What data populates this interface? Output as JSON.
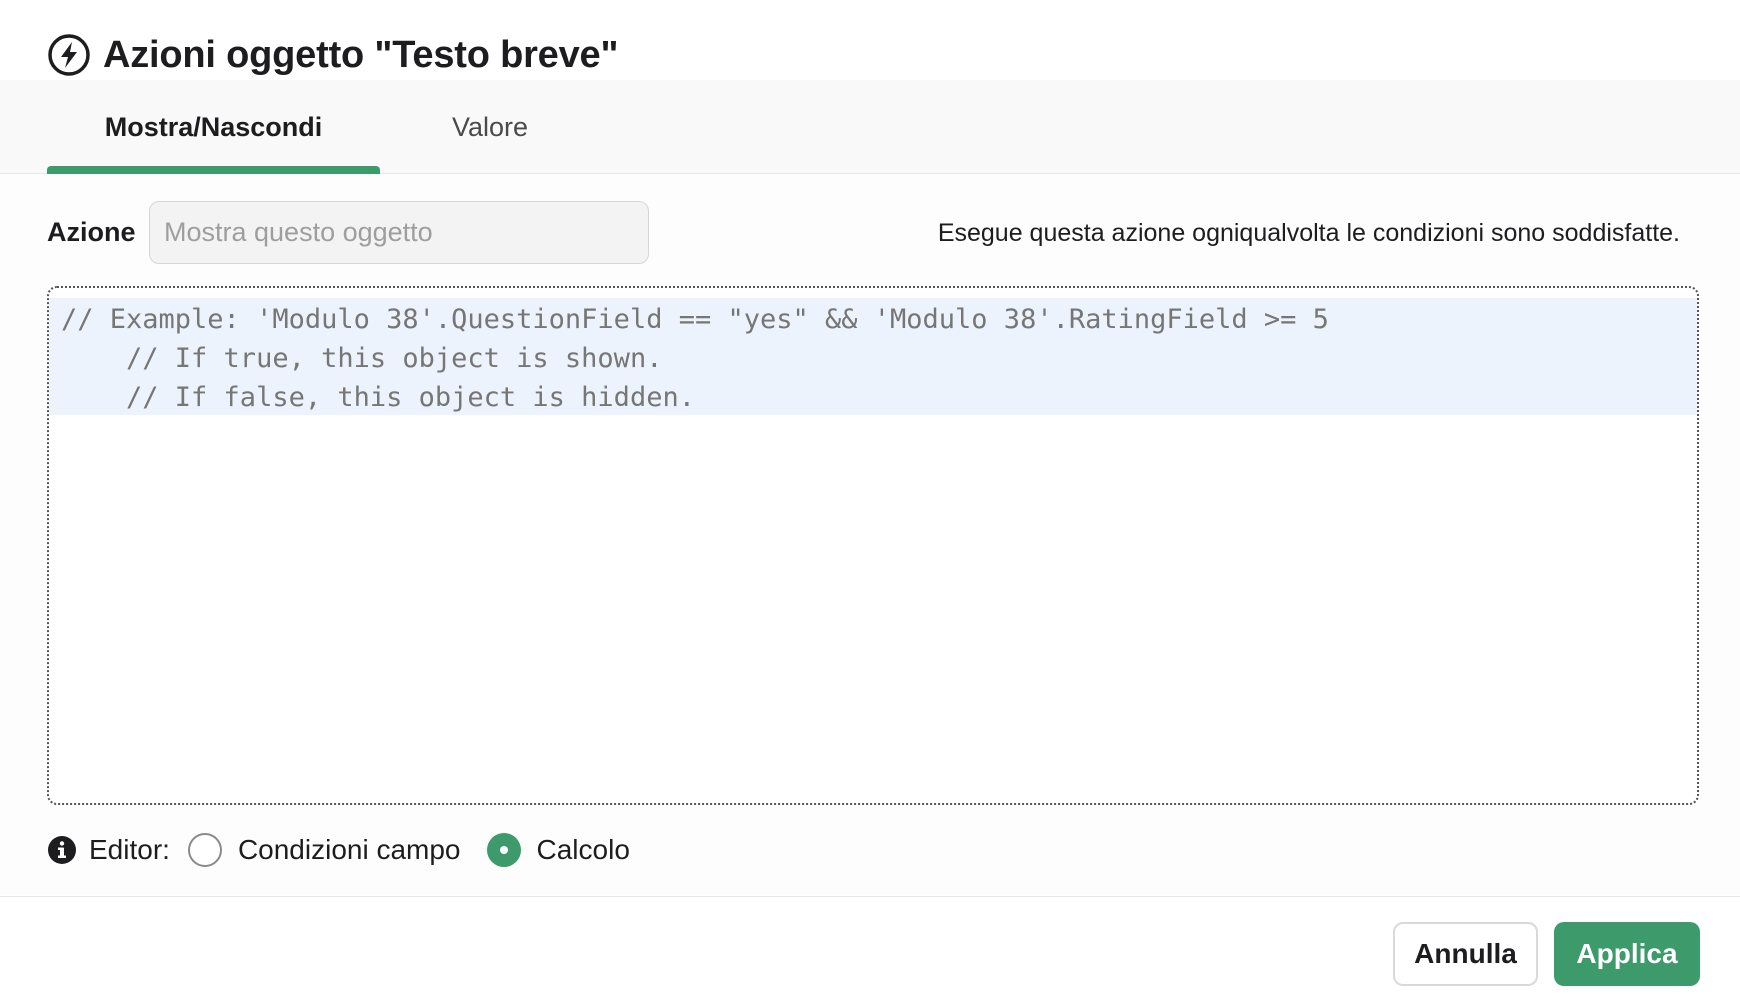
{
  "dialog": {
    "title": "Azioni oggetto \"Testo breve\"",
    "title_icon": "lightning-bolt-icon"
  },
  "tabs": [
    {
      "label": "Mostra/Nascondi",
      "active": true
    },
    {
      "label": "Valore",
      "active": false
    }
  ],
  "action": {
    "label": "Azione",
    "placeholder": "Mostra questo oggetto",
    "hint": "Esegue questa azione ogniqualvolta le condizioni sono soddisfatte."
  },
  "editor": {
    "code_lines": [
      "// Example: 'Modulo 38'.QuestionField == \"yes\" && 'Modulo 38'.RatingField >= 5",
      "    // If true, this object is shown.",
      "    // If false, this object is hidden."
    ]
  },
  "editor_mode": {
    "label": "Editor:",
    "info_icon": "info-icon",
    "options": [
      {
        "label": "Condizioni campo",
        "selected": false
      },
      {
        "label": "Calcolo",
        "selected": true
      }
    ]
  },
  "footer": {
    "cancel_label": "Annulla",
    "apply_label": "Applica"
  },
  "colors": {
    "accent": "#3d9a6a",
    "editor_highlight": "#edf3fd",
    "code_text": "#767676"
  }
}
